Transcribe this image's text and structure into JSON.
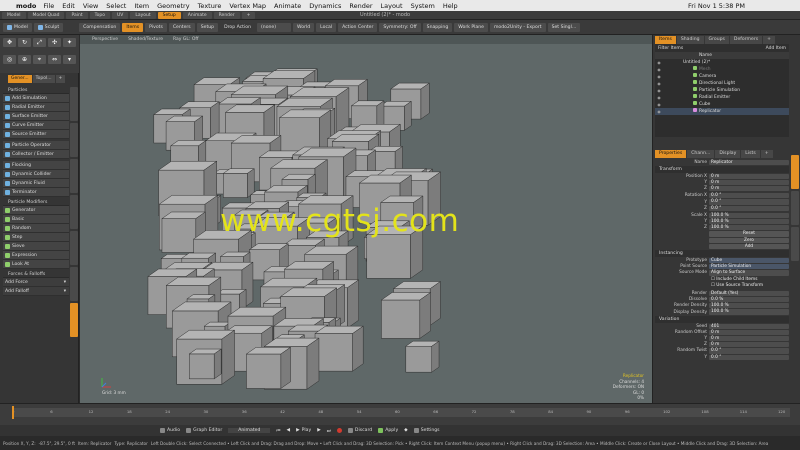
{
  "menubar": {
    "apple": "",
    "app_name": "modo",
    "items": [
      "File",
      "Edit",
      "View",
      "Select",
      "Item",
      "Geometry",
      "Texture",
      "Vertex Map",
      "Animate",
      "Dynamics",
      "Render",
      "Layout",
      "System",
      "Help"
    ],
    "clock": "Fri Nov 1 5:38 PM"
  },
  "window_title": "Untitled (2)* - modo",
  "layout_tabs": [
    "Model",
    "Model Quad",
    "Paint",
    "Topo",
    "UV",
    "Layout",
    "Setup",
    "Animate",
    "Render",
    "+"
  ],
  "layout_active": "Setup",
  "toolbar": {
    "model_mode": "Model",
    "sculpt": "Sculpt",
    "compensation": "Compensation",
    "items": "Items",
    "pivots": "Pivots",
    "centers": "Centers",
    "setup": "Setup",
    "drop_action_label": "Drop Action",
    "drop_action_value": "(none)",
    "world": "World",
    "local": "Local",
    "action_center": "Action Center",
    "symmetry": "Symmetry: Off",
    "snapping": "Snapping",
    "work_plane": "Work Plane",
    "modo2unity": "modo2Unity - Export",
    "set_single": "Set Singl..."
  },
  "left_tabs": [
    "Gener...",
    "Topol...",
    "+"
  ],
  "left_sections": {
    "particles": "Particles",
    "particle_modifiers": "Particle Modifiers",
    "forces": "Forces & Falloffs"
  },
  "particles_items": [
    "Add Simulation",
    "Radial Emitter",
    "Surface Emitter",
    "Curve Emitter",
    "Source Emitter",
    "Particle Operator",
    "Collector / Emitter",
    "Flocking",
    "Dynamic Collider",
    "Dynamic Fluid",
    "Terminator"
  ],
  "modifier_items": [
    "Generator",
    "Basic",
    "Random",
    "Step",
    "Sieve",
    "Expression",
    "Look At"
  ],
  "forces_items": [
    "Add Force",
    "Add Falloff"
  ],
  "viewport": {
    "view_modes": [
      "Perspective",
      "Shaded/Texture",
      "Ray GL: Off"
    ],
    "watermark": "www.cgtsj.com",
    "info_lines": [
      "Replicator",
      "Channels: 4",
      "Deformers: ON",
      "GL: 0",
      "0%"
    ],
    "grid_step": "Grid: 3 mm"
  },
  "right_top_tabs": [
    "Items",
    "Shading",
    "Groups",
    "Deformers",
    "+"
  ],
  "item_filter_label": "Filter Items",
  "add_item_label": "Add Item",
  "item_list_header": "Name",
  "items_tree": [
    {
      "name": "Untitled (2)*",
      "selected": false
    },
    {
      "name": "Mesh",
      "selected": false
    },
    {
      "name": "Camera",
      "selected": false
    },
    {
      "name": "Directional Light",
      "selected": false
    },
    {
      "name": "Particle Simulation",
      "selected": false
    },
    {
      "name": "Radial Emitter",
      "selected": false
    },
    {
      "name": "Cube",
      "selected": false
    },
    {
      "name": "Replicator",
      "selected": true
    }
  ],
  "prop_tabs": [
    "Properties",
    "Chann...",
    "Display",
    "Lists",
    "+"
  ],
  "properties": {
    "name_label": "Name",
    "name_value": "Replicator",
    "transform_section": "Transform",
    "position": [
      "0 m",
      "0 m",
      "0 m"
    ],
    "rotation": [
      "0.0 °",
      "0.0 °",
      "0.0 °"
    ],
    "scale": [
      "100.0 %",
      "100.0 %",
      "100.0 %"
    ],
    "reset": "Reset",
    "zero": "Zero",
    "add": "Add",
    "instancing_section": "Instancing",
    "prototype_label": "Prototype",
    "prototype_value": "Cube",
    "point_source_label": "Point Source",
    "point_source_value": "Particle Simulation",
    "source_mode_label": "Source Mode",
    "source_mode_value": "Align to Surface",
    "include_child": "Include Child Items",
    "use_source_transform": "Use Source Transform",
    "render_label": "Render",
    "render_value": "Default (Yes)",
    "dissolve_label": "Dissolve",
    "dissolve_value": "0.0 %",
    "render_density_label": "Render Density",
    "render_density_value": "100.0 %",
    "display_density_label": "Display Density",
    "display_density_value": "100.0 %",
    "variation_section": "Variation",
    "seed_label": "Seed",
    "seed_value": "401",
    "random_offset_label": "Random Offset",
    "random_offset": [
      "0 m",
      "0 m",
      "0 m"
    ],
    "random_twist_label": "Random Twist",
    "random_twist": [
      "0.0 °",
      "0.0 °"
    ]
  },
  "timeline_ticks": [
    "0",
    "6",
    "12",
    "18",
    "24",
    "30",
    "36",
    "42",
    "48",
    "54",
    "60",
    "66",
    "72",
    "78",
    "84",
    "90",
    "96",
    "102",
    "108",
    "114",
    "120"
  ],
  "controls": {
    "audio": "Audio",
    "graph_editor": "Graph Editor",
    "animated": "Animated",
    "play": "Play",
    "discard": "Discard",
    "apply": "Apply",
    "settings": "Settings"
  },
  "status": {
    "position": "Position X, Y, Z:",
    "coords": "-87.5\", 29.5\", 0 ft",
    "item": "Item: Replicator",
    "type": "Type: Replicator",
    "hint": "Left Double Click: Select Connected • Left Click and Drag: Drag and Drop: Move • Left Click and Drag: 3D Selection: Pick • Right Click: Item Context Menu (popup menu) • Right Click and Drag: 3D Selection: Area • Middle Click: Create or Close Layout • Middle Click and Drag: 3D Selection: Area"
  },
  "colors": {
    "accent": "#e39125",
    "viewport_bg": "#5f6868",
    "watermark": "#e3e31a"
  }
}
